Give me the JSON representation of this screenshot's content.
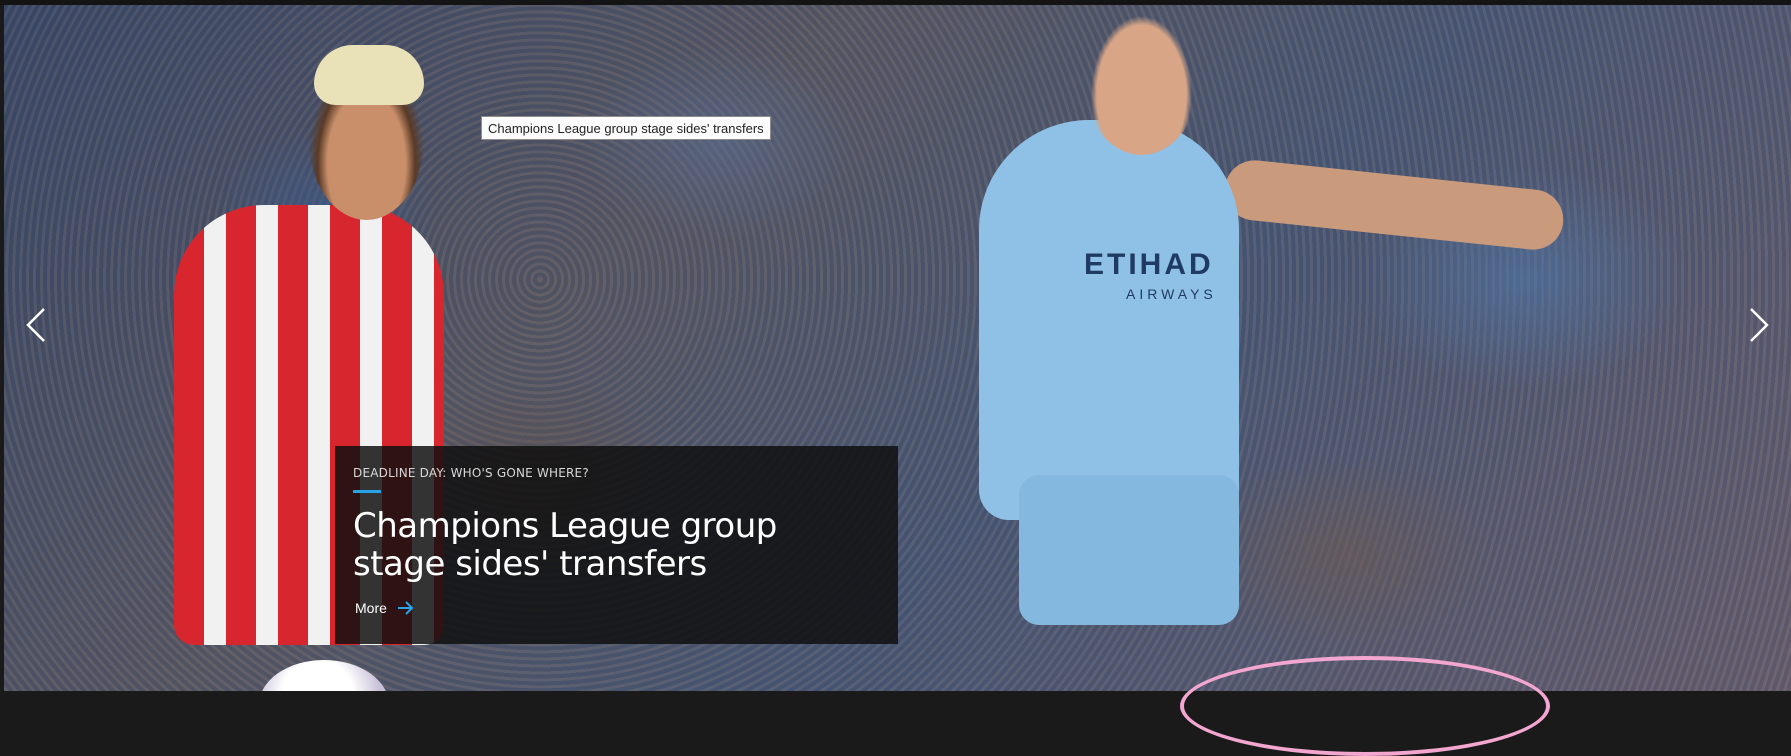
{
  "hero": {
    "tooltip": "Champions League group stage sides' transfers",
    "sponsor_text": "ETIHAD",
    "sponsor_sub": "AIRWAYS",
    "prev_icon": "chevron-left-icon",
    "next_icon": "chevron-right-icon"
  },
  "caption": {
    "kicker": "Deadline Day: Who's gone where?",
    "title": "Champions League group stage sides' transfers",
    "more_label": "More",
    "more_icon": "arrow-right-icon",
    "accent_color": "#27a4e6"
  }
}
